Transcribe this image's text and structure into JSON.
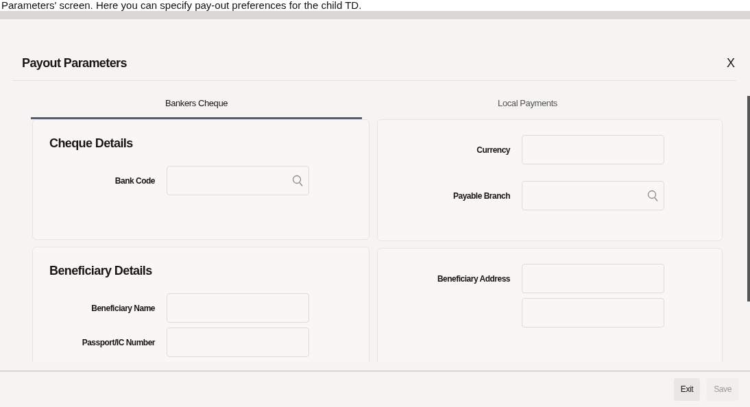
{
  "caption": "Parameters' screen. Here you can specify pay-out preferences for the child TD.",
  "dialog": {
    "title": "Payout Parameters",
    "close": "X"
  },
  "tabs": [
    {
      "label": "Bankers Cheque",
      "selected": true
    },
    {
      "label": "Local Payments",
      "selected": false
    }
  ],
  "left_panels": [
    {
      "heading": "Cheque Details",
      "fields": [
        {
          "label": "Bank Code",
          "lookup": true
        }
      ]
    },
    {
      "heading": "Beneficiary Details",
      "fields": [
        {
          "label": "Beneficiary Name",
          "lookup": false
        },
        {
          "label": "Passport/IC Number",
          "lookup": false
        }
      ]
    }
  ],
  "right_panels": [
    {
      "fields": [
        {
          "label": "Currency",
          "lookup": false
        },
        {
          "label": "Payable Branch",
          "lookup": true
        }
      ]
    },
    {
      "fields": [
        {
          "label": "Beneficiary Address",
          "lookup": false
        },
        {
          "lookup": false
        }
      ]
    }
  ],
  "buttons": [
    {
      "label": "Exit",
      "disabled": false
    },
    {
      "label": "Save",
      "disabled": true
    }
  ]
}
